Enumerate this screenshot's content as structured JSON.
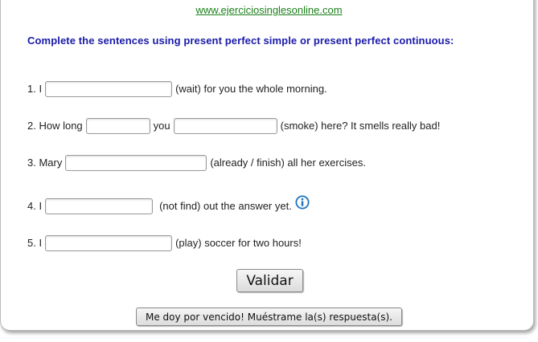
{
  "header": {
    "site_link": "www.ejerciciosinglesonline.com",
    "instruction": "Complete the sentences using present perfect simple or present perfect continuous:"
  },
  "exercises": [
    {
      "number": "1. I",
      "after": "(wait) for you the whole morning."
    },
    {
      "number": "2. How long",
      "middle": "you",
      "after": "(smoke) here? It smells really bad!"
    },
    {
      "number": "3. Mary",
      "after": "(already / finish) all her exercises."
    },
    {
      "number": "4. I",
      "after": "(not find) out the answer yet."
    },
    {
      "number": "5. I",
      "after": "(play) soccer for two hours!"
    }
  ],
  "buttons": {
    "validate": "Validar",
    "give_up": "Me doy por vencido! Muéstrame la(s) respuesta(s)."
  },
  "colors": {
    "link": "#1a7f1a",
    "instruction": "#1a1aaa",
    "info_icon": "#1e73be"
  },
  "icons": {
    "info": "info-circle-icon"
  }
}
